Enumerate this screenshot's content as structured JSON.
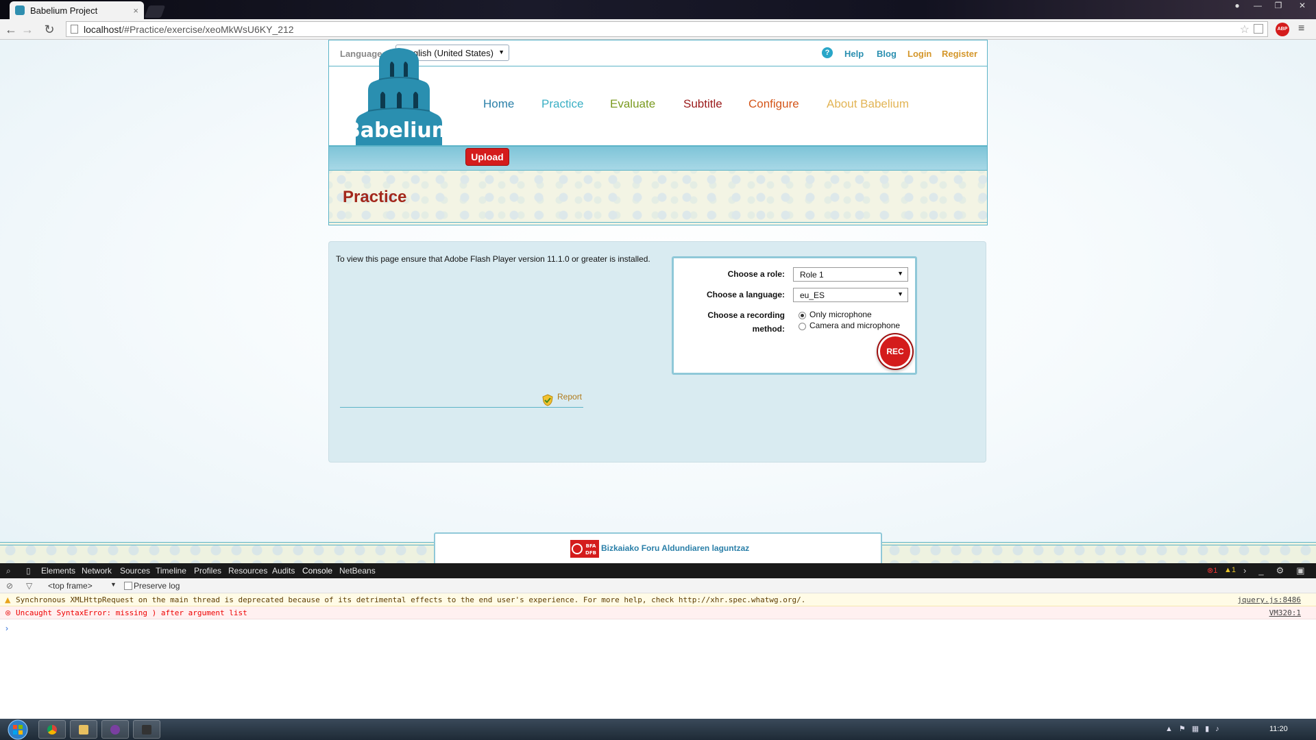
{
  "browser": {
    "tab_title": "Babelium Project",
    "tab_close": "×",
    "url_host": "localhost",
    "url_path": "/#Practice/exercise/xeoMkWsU6KY_212",
    "abp_label": "ABP"
  },
  "topbar": {
    "language_label": "Language:",
    "language_value": "English (United States)",
    "help_icon": "?",
    "links": {
      "help": "Help",
      "blog": "Blog",
      "login": "Login",
      "register": "Register"
    }
  },
  "logo": {
    "text": "Babelium",
    "color": "#2a8fb0"
  },
  "nav": {
    "home": "Home",
    "practice": "Practice",
    "evaluate": "Evaluate",
    "subtitle": "Subtitle",
    "configure": "Configure",
    "about": "About Babelium"
  },
  "upload_label": "Upload",
  "page_title": "Practice",
  "content": {
    "flash_message": "To view this page ensure that Adobe Flash Player version 11.1.0 or greater is installed.",
    "report_label": "Report"
  },
  "role_panel": {
    "role_label": "Choose a role:",
    "role_value": "Role 1",
    "language_label": "Choose a language:",
    "language_value": "eu_ES",
    "method_label_1": "Choose a recording",
    "method_label_2": "method:",
    "options": [
      "Only microphone",
      "Camera and microphone"
    ],
    "selected_option": "Only microphone",
    "rec_label": "REC"
  },
  "footer": {
    "sponsor_text": "Bizkaiako Foru Aldundiaren laguntzaz",
    "sponsor_logo_text": [
      "BFA",
      "DFB"
    ]
  },
  "devtools": {
    "tabs": [
      "Elements",
      "Network",
      "Sources",
      "Timeline",
      "Profiles",
      "Resources",
      "Audits",
      "Console",
      "NetBeans"
    ],
    "error_count": "1",
    "warning_count": "1",
    "frame_selector": "<top frame>",
    "preserve_log_label": "Preserve log",
    "messages": [
      {
        "level": "warning",
        "text": "Synchronous XMLHttpRequest on the main thread is deprecated because of its detrimental effects to the end user's experience. For more help, check http://xhr.spec.whatwg.org/.",
        "source": "jquery.js:8486"
      },
      {
        "level": "error",
        "text": "Uncaught SyntaxError: missing ) after argument list",
        "source": "VM320:1"
      }
    ],
    "prompt": "›"
  },
  "taskbar": {
    "clock": "11:20"
  },
  "colors": {
    "accent_teal": "#5bb3c7",
    "upload_red": "#d41c1c",
    "title_red": "#a3281c",
    "link_orange": "#d4962a"
  }
}
